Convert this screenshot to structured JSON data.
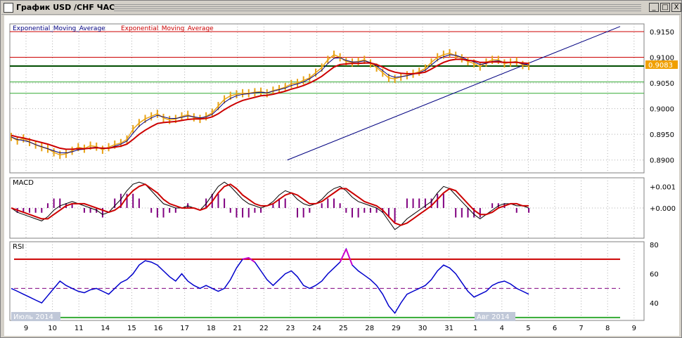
{
  "window": {
    "title": "График USD /CHF ЧАС",
    "buttons": [
      "_",
      "□",
      "X"
    ]
  },
  "colors": {
    "price": "#e8a317",
    "ema_fast": "#000080",
    "ema_slow": "#cc0000",
    "resistance": "#cc0000",
    "support": "#33aa33",
    "level": "#004d00",
    "trendline": "#000080",
    "macd_hist": "#800080",
    "rsi": "#0000cc",
    "rsi_overbought": "#cc00cc",
    "price_tag": "#f0a000"
  },
  "chart_data": [
    {
      "type": "line",
      "panel": "price",
      "legend": [
        "Exponential_Moving_Average",
        "Exponential_Moving_Average"
      ],
      "ylim": [
        0.8875,
        0.9165
      ],
      "yticks": [
        "0.9150",
        "0.9100",
        "0.9050",
        "0.9000",
        "0.8950",
        "0.8900"
      ],
      "last_price": "0.9083",
      "hlines": {
        "resistance": [
          0.915,
          0.91
        ],
        "level": 0.9083,
        "support": [
          0.9052,
          0.903
        ]
      },
      "trendline": {
        "from": [
          13.6,
          0.89
        ],
        "to": [
          30.0,
          0.916
        ]
      },
      "x": [
        0,
        0.3,
        0.6,
        0.9,
        1.2,
        1.5,
        1.8,
        2.1,
        2.4,
        2.7,
        3.0,
        3.3,
        3.6,
        3.9,
        4.2,
        4.5,
        4.8,
        5.1,
        5.4,
        5.7,
        6.0,
        6.3,
        6.6,
        6.9,
        7.2,
        7.5,
        7.8,
        8.1,
        8.4,
        8.7,
        9.0,
        9.3,
        9.6,
        9.9,
        10.2,
        10.5,
        10.8,
        11.1,
        11.4,
        11.7,
        12.0,
        12.3,
        12.6,
        12.9,
        13.2,
        13.5,
        13.8,
        14.1,
        14.4,
        14.7,
        15.0,
        15.3,
        15.6,
        15.9,
        16.2,
        16.5,
        16.8,
        17.1,
        17.4,
        17.7,
        18.0,
        18.3,
        18.6,
        18.9,
        19.2,
        19.5,
        19.8,
        20.1,
        20.4,
        20.7,
        21.0,
        21.3,
        21.6,
        21.9,
        22.2,
        22.5,
        22.8,
        23.1,
        23.4,
        23.7,
        24.0,
        24.3,
        24.6,
        24.9,
        25.2,
        25.5,
        25.8,
        26.1,
        26.4,
        26.7,
        27.0,
        27.3,
        27.6,
        27.9,
        28.2,
        28.5,
        28.8,
        29.1,
        29.4,
        29.7,
        30.0
      ],
      "price": [
        0.8945,
        0.8938,
        0.8942,
        0.8935,
        0.893,
        0.8925,
        0.8922,
        0.8915,
        0.891,
        0.8912,
        0.8918,
        0.8925,
        0.8922,
        0.8928,
        0.8926,
        0.892,
        0.8925,
        0.893,
        0.8933,
        0.894,
        0.896,
        0.8972,
        0.898,
        0.8985,
        0.899,
        0.8982,
        0.8978,
        0.898,
        0.8985,
        0.8988,
        0.8983,
        0.898,
        0.8985,
        0.8992,
        0.9005,
        0.9018,
        0.9025,
        0.9028,
        0.903,
        0.903,
        0.9032,
        0.9033,
        0.903,
        0.9035,
        0.9038,
        0.9042,
        0.9048,
        0.905,
        0.9055,
        0.906,
        0.907,
        0.908,
        0.9095,
        0.9105,
        0.91,
        0.9092,
        0.909,
        0.9092,
        0.9095,
        0.9088,
        0.908,
        0.907,
        0.906,
        0.9058,
        0.9062,
        0.9065,
        0.9068,
        0.9072,
        0.9078,
        0.909,
        0.91,
        0.9105,
        0.9108,
        0.9103,
        0.9098,
        0.9092,
        0.9088,
        0.9082,
        0.909,
        0.9095,
        0.9095,
        0.9088,
        0.909,
        0.9092,
        0.9085,
        0.9083
      ],
      "ema_fast": [
        0.8945,
        0.894,
        0.8938,
        0.8935,
        0.893,
        0.8926,
        0.8922,
        0.8918,
        0.8914,
        0.8914,
        0.8916,
        0.892,
        0.8921,
        0.8924,
        0.8925,
        0.8922,
        0.8923,
        0.8927,
        0.8931,
        0.8937,
        0.8952,
        0.8966,
        0.8975,
        0.8982,
        0.8987,
        0.8984,
        0.8981,
        0.8981,
        0.8983,
        0.8986,
        0.8984,
        0.8982,
        0.8984,
        0.8989,
        0.9,
        0.9012,
        0.902,
        0.9025,
        0.9028,
        0.9029,
        0.9031,
        0.9032,
        0.9031,
        0.9034,
        0.9037,
        0.904,
        0.9045,
        0.9048,
        0.9052,
        0.9058,
        0.9066,
        0.9075,
        0.9088,
        0.9098,
        0.9099,
        0.9094,
        0.9091,
        0.9091,
        0.9093,
        0.909,
        0.9083,
        0.9074,
        0.9065,
        0.9061,
        0.9062,
        0.9064,
        0.9067,
        0.907,
        0.9075,
        0.9085,
        0.9095,
        0.9101,
        0.9105,
        0.9104,
        0.91,
        0.9095,
        0.9091,
        0.9086,
        0.9088,
        0.9092,
        0.9093,
        0.909,
        0.909,
        0.9091,
        0.9087,
        0.9085
      ],
      "ema_slow": [
        0.8948,
        0.8945,
        0.8943,
        0.894,
        0.8937,
        0.8934,
        0.8931,
        0.8927,
        0.8923,
        0.8921,
        0.8921,
        0.8922,
        0.8922,
        0.8923,
        0.8924,
        0.8923,
        0.8923,
        0.8925,
        0.8927,
        0.8931,
        0.894,
        0.895,
        0.8958,
        0.8965,
        0.8971,
        0.8973,
        0.8974,
        0.8975,
        0.8977,
        0.8979,
        0.898,
        0.898,
        0.8981,
        0.8984,
        0.899,
        0.8998,
        0.9005,
        0.9011,
        0.9016,
        0.9019,
        0.9022,
        0.9025,
        0.9026,
        0.9028,
        0.9031,
        0.9034,
        0.9038,
        0.9041,
        0.9045,
        0.905,
        0.9056,
        0.9063,
        0.9072,
        0.9081,
        0.9086,
        0.9087,
        0.9088,
        0.9088,
        0.9089,
        0.9089,
        0.9086,
        0.9081,
        0.9075,
        0.9071,
        0.9069,
        0.9068,
        0.9068,
        0.9069,
        0.9071,
        0.9077,
        0.9084,
        0.909,
        0.9094,
        0.9096,
        0.9096,
        0.9094,
        0.9093,
        0.909,
        0.909,
        0.9091,
        0.9091,
        0.909,
        0.909,
        0.909,
        0.9089,
        0.9088
      ]
    },
    {
      "type": "line",
      "panel": "macd",
      "legend": [
        "MACD"
      ],
      "ylim": [
        -0.0014,
        0.0014
      ],
      "yticks": [
        "+0.001",
        "+0.000"
      ],
      "macd": [
        0.0,
        -0.0002,
        -0.0003,
        -0.0004,
        -0.0005,
        -0.0006,
        -0.0004,
        -0.0001,
        0.0001,
        0.0002,
        0.0003,
        0.0002,
        0.0001,
        0.0,
        -0.0001,
        -0.0003,
        -0.0002,
        0.0001,
        0.0004,
        0.0008,
        0.0011,
        0.0012,
        0.0011,
        0.0008,
        0.0005,
        0.0002,
        0.0001,
        0.0,
        0.0,
        0.0001,
        0.0,
        -0.0001,
        0.0002,
        0.0006,
        0.001,
        0.0012,
        0.001,
        0.0007,
        0.0004,
        0.0002,
        0.0001,
        0.0,
        0.0001,
        0.0003,
        0.0006,
        0.0008,
        0.0007,
        0.0004,
        0.0002,
        0.0001,
        0.0002,
        0.0004,
        0.0007,
        0.0009,
        0.001,
        0.0008,
        0.0005,
        0.0003,
        0.0002,
        0.0001,
        0.0,
        -0.0002,
        -0.0006,
        -0.001,
        -0.0008,
        -0.0005,
        -0.0003,
        -0.0001,
        0.0001,
        0.0003,
        0.0007,
        0.001,
        0.0009,
        0.0006,
        0.0003,
        0.0,
        -0.0003,
        -0.0005,
        -0.0003,
        -0.0001,
        0.0001,
        0.0002,
        0.0002,
        0.0001,
        0.0001,
        0.0
      ],
      "signal": [
        0.0,
        -0.0001,
        -0.0002,
        -0.0003,
        -0.0004,
        -0.0005,
        -0.0005,
        -0.0003,
        -0.0001,
        0.0001,
        0.0002,
        0.0002,
        0.0002,
        0.0001,
        0.0,
        -0.0001,
        -0.0002,
        -0.0001,
        0.0001,
        0.0005,
        0.0008,
        0.001,
        0.0011,
        0.0009,
        0.0007,
        0.0004,
        0.0002,
        0.0001,
        0.0,
        0.0,
        0.0,
        -0.0001,
        0.0,
        0.0003,
        0.0007,
        0.001,
        0.0011,
        0.0009,
        0.0006,
        0.0004,
        0.0002,
        0.0001,
        0.0001,
        0.0002,
        0.0004,
        0.0006,
        0.0007,
        0.0006,
        0.0004,
        0.0002,
        0.0002,
        0.0003,
        0.0005,
        0.0007,
        0.0009,
        0.0009,
        0.0007,
        0.0005,
        0.0003,
        0.0002,
        0.0001,
        -0.0001,
        -0.0004,
        -0.0007,
        -0.0008,
        -0.0007,
        -0.0005,
        -0.0003,
        -0.0001,
        0.0001,
        0.0004,
        0.0007,
        0.0009,
        0.0008,
        0.0005,
        0.0002,
        -0.0001,
        -0.0003,
        -0.0003,
        -0.0002,
        0.0,
        0.0001,
        0.0002,
        0.0002,
        0.0001,
        0.0001
      ]
    },
    {
      "type": "line",
      "panel": "rsi",
      "legend": [
        "RSI"
      ],
      "ylim": [
        28,
        82
      ],
      "yticks": [
        "80",
        "60",
        "40"
      ],
      "overbought": 70,
      "oversold": 30,
      "mid": 50,
      "rsi": [
        50,
        48,
        46,
        44,
        42,
        40,
        45,
        50,
        55,
        52,
        50,
        48,
        47,
        49,
        50,
        48,
        46,
        50,
        54,
        56,
        60,
        66,
        69,
        68,
        66,
        62,
        58,
        55,
        60,
        55,
        52,
        50,
        52,
        50,
        48,
        50,
        56,
        64,
        70,
        71,
        68,
        62,
        56,
        52,
        56,
        60,
        62,
        58,
        52,
        50,
        52,
        55,
        60,
        64,
        68,
        77,
        66,
        62,
        59,
        56,
        52,
        46,
        38,
        33,
        40,
        46,
        48,
        50,
        52,
        56,
        62,
        66,
        64,
        60,
        54,
        48,
        44,
        46,
        48,
        52,
        54,
        55,
        53,
        50,
        48,
        46
      ]
    }
  ],
  "time_axis": {
    "labels": [
      "9",
      "10",
      "11",
      "14",
      "15",
      "16",
      "17",
      "18",
      "21",
      "22",
      "23",
      "24",
      "25",
      "28",
      "29",
      "30",
      "31",
      "1",
      "4",
      "5",
      "6",
      "7",
      "8",
      "9"
    ],
    "month_labels": [
      "Июль 2014",
      "Авг 2014"
    ]
  }
}
